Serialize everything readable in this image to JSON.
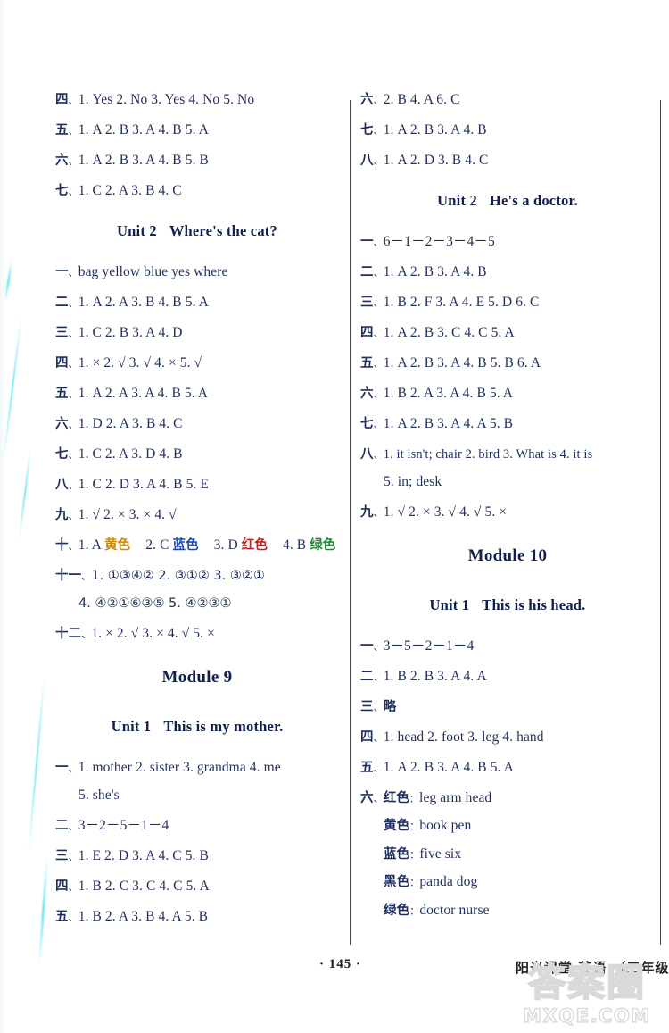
{
  "page": {
    "page_number": "·  145  ·",
    "book_info": "阳光课堂  英语  （三年级上",
    "watermark_cjk": "答案圈",
    "watermark_en": "MXQE.COM"
  },
  "left_column": {
    "answers_top": [
      {
        "num": "四",
        "body": "1. Yes   2. No   3. Yes   4. No   5. No"
      },
      {
        "num": "五",
        "body": "1. A    2. B    3. A    4. B    5. A"
      },
      {
        "num": "六",
        "body": "1. A   2. B   3. A   4. B   5. B"
      },
      {
        "num": "七",
        "body": "1. C   2. A   3. B   4. C"
      }
    ],
    "unit2": {
      "label": "Unit 2",
      "title": "Where's the cat?",
      "answers": [
        {
          "num": "一",
          "body": "bag   yellow   blue   yes   where"
        },
        {
          "num": "二",
          "body": "1. A   2. A   3. B   4. B   5. A"
        },
        {
          "num": "三",
          "body": "1. C   2. B   3. A   4. D"
        },
        {
          "num": "四",
          "body": "1. ×   2. √   3. √   4. ×   5. √"
        },
        {
          "num": "五",
          "body": "1. A   2. A   3. A   4. B   5. A"
        },
        {
          "num": "六",
          "body": "1. D   2. A   3. B   4. C"
        },
        {
          "num": "七",
          "body": "1. C   2. A   3. D   4. B"
        },
        {
          "num": "八",
          "body": "1. C   2. D   3. A   4. B   5. E"
        },
        {
          "num": "九",
          "body": "1. √   2. ×   3. ×   4. √"
        }
      ],
      "item_ten": {
        "num": "十",
        "parts": [
          {
            "prefix": "1. A ",
            "word": "黄色",
            "color": "yellow"
          },
          {
            "prefix": "2. C ",
            "word": "蓝色",
            "color": "blue"
          },
          {
            "prefix": "3. D ",
            "word": "红色",
            "color": "red"
          },
          {
            "prefix": "4. B ",
            "word": "绿色",
            "color": "green"
          }
        ]
      },
      "item_eleven": {
        "num": "十一",
        "line1": "1. ①③④②    2. ③①②    3. ③②①",
        "line2": "4. ④②①⑥③⑤    5. ④②③①"
      },
      "item_twelve": {
        "num": "十二",
        "body": "1. ×   2. √   3. ×   4. √   5. ×"
      }
    },
    "module9": {
      "title": "Module 9",
      "unit1": {
        "label": "Unit 1",
        "title": "This is my mother.",
        "answers": [
          {
            "num": "一",
            "body": "1. mother   2. sister   3. grandma   4. me"
          },
          {
            "num": "",
            "body": "5. she's",
            "continuation": true
          },
          {
            "num": "二",
            "body": "3－2－5－1－4"
          },
          {
            "num": "三",
            "body": "1. E   2. D   3. A   4. C   5. B"
          },
          {
            "num": "四",
            "body": "1. B   2. C   3. C   4. C   5. A"
          },
          {
            "num": "五",
            "body": "1. B   2. A   3. B   4. A   5. B"
          }
        ]
      }
    }
  },
  "right_column": {
    "answers_top": [
      {
        "num": "六",
        "body": "2. B   4. A   6. C"
      },
      {
        "num": "七",
        "body": "1. A   2. B   3. A   4. B"
      },
      {
        "num": "八",
        "body": "1. A   2. D   3. B   4. C"
      }
    ],
    "unit2": {
      "label": "Unit 2",
      "title": "He's a doctor.",
      "answers": [
        {
          "num": "一",
          "body": "6－1－2－3－4－5"
        },
        {
          "num": "二",
          "body": "1. A   2. B   3. A   4. B"
        },
        {
          "num": "三",
          "body": "1. B   2. F   3. A   4. E   5. D   6. C"
        },
        {
          "num": "四",
          "body": "1. A   2. B   3. C   4. C   5. A"
        },
        {
          "num": "五",
          "body": "1. A   2. B   3. A   4. B   5. B   6. A"
        },
        {
          "num": "六",
          "body": "1. B   2. A   3. A   4. B   5. A"
        },
        {
          "num": "七",
          "body": "1. A   2. B   3. A   4. A   5. B"
        },
        {
          "num": "八",
          "body": "1. it isn't; chair   2. bird   3. What is   4. it is"
        },
        {
          "num": "",
          "body": "5. in; desk",
          "continuation": true
        },
        {
          "num": "九",
          "body": "1. √   2. ×   3. √   4. √   5. ×"
        }
      ]
    },
    "module10": {
      "title": "Module 10",
      "unit1": {
        "label": "Unit 1",
        "title": "This is his head.",
        "answers": [
          {
            "num": "一",
            "body": "3－5－2－1－4"
          },
          {
            "num": "二",
            "body": "1. B   2. B   3. A   4. A"
          },
          {
            "num": "三",
            "body": "略",
            "cjk": true
          },
          {
            "num": "四",
            "body": "1. head   2. foot   3. leg   4. hand"
          },
          {
            "num": "五",
            "body": "1. A   2. B   3. A   4. B   5. A"
          }
        ],
        "item_six": {
          "num": "六",
          "rows": [
            {
              "label": "红色",
              "value": "leg    arm    head"
            },
            {
              "label": "黄色",
              "value": "book    pen"
            },
            {
              "label": "蓝色",
              "value": "five    six"
            },
            {
              "label": "黑色",
              "value": "panda    dog"
            },
            {
              "label": "绿色",
              "value": "doctor    nurse"
            }
          ]
        }
      }
    }
  }
}
